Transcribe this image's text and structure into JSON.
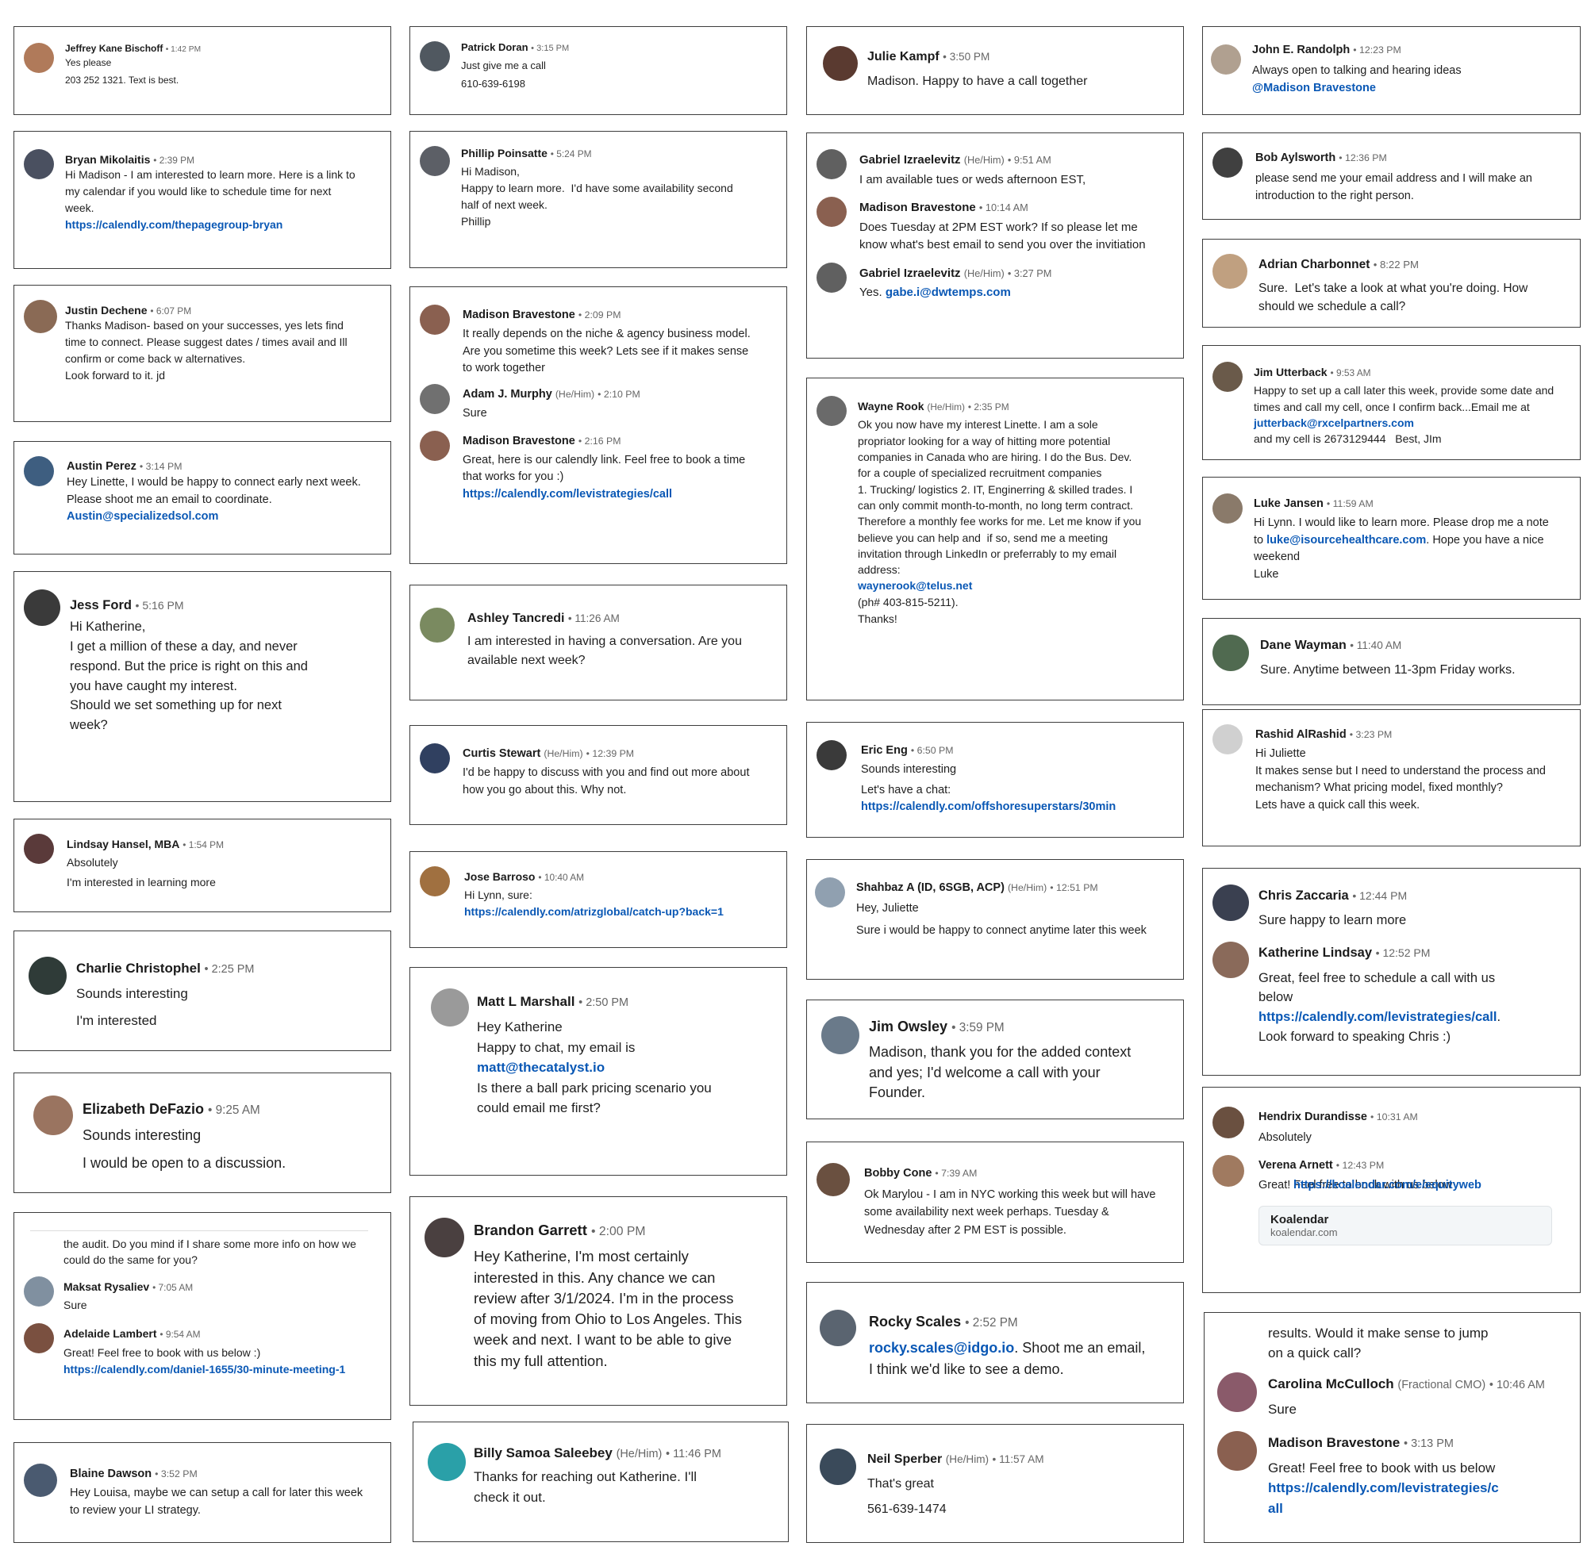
{
  "colors": {
    "link": "#0a58b5",
    "border": "#3d3d3d",
    "name": "#1b1b1b",
    "meta": "#666666"
  },
  "cards": [
    {
      "id": "c1",
      "messages": [
        {
          "name": "Jeffrey Kane Bischoff",
          "time": "1:42 PM",
          "lines": [
            "Yes please",
            "203 252 1321. Text is best."
          ]
        }
      ]
    },
    {
      "id": "c2",
      "messages": [
        {
          "name": "Bryan Mikolaitis",
          "time": "2:39 PM",
          "lines": [
            "Hi Madison - I am interested to learn more. Here is a link to my calendar if you would like to schedule time for next week.",
            ""
          ],
          "link": "https://calendly.com/thepagegroup-bryan"
        }
      ]
    },
    {
      "id": "c3",
      "messages": [
        {
          "name": "Justin Dechene",
          "time": "6:07 PM",
          "lines": [
            "Thanks Madison- based on your successes, yes lets find time to connect. Please suggest dates / times avail and Ill confirm or come back w alternatives.",
            "",
            "Look forward to it. jd"
          ]
        }
      ]
    },
    {
      "id": "c4",
      "messages": [
        {
          "name": "Austin Perez",
          "time": "3:14 PM",
          "lines": [
            "Hey Linette, I would be happy to connect early next week. Please shoot me an email to coordinate."
          ],
          "link": "Austin@specializedsol.com"
        }
      ]
    },
    {
      "id": "c5",
      "messages": [
        {
          "name": "Jess Ford",
          "time": "5:16 PM",
          "lines": [
            "Hi Katherine,",
            "",
            "I get a million of these a day, and never respond. But the price is right on this and you have caught my interest.",
            "",
            "Should we set something up for next week?"
          ]
        }
      ]
    },
    {
      "id": "c6",
      "messages": [
        {
          "name": "Lindsay Hansel, MBA",
          "time": "1:54 PM",
          "lines": [
            "Absolutely",
            "I'm interested in learning more"
          ]
        }
      ]
    },
    {
      "id": "c7",
      "messages": [
        {
          "name": "Charlie Christophel",
          "time": "2:25 PM",
          "lines": [
            "Sounds interesting",
            "I'm interested"
          ]
        }
      ]
    },
    {
      "id": "c8",
      "messages": [
        {
          "name": "Elizabeth DeFazio",
          "time": "9:25 AM",
          "lines": [
            "Sounds interesting",
            "I would be open to a discussion."
          ]
        }
      ]
    },
    {
      "id": "c9",
      "pre": "the audit. Do you mind if I share some more info on how we could do the same for you?",
      "messages": [
        {
          "name": "Maksat Rysaliev",
          "time": "7:05 AM",
          "lines": [
            "Sure"
          ]
        },
        {
          "name": "Adelaide Lambert",
          "time": "9:54 AM",
          "lines": [
            "Great! Feel free to book with us below :)"
          ],
          "link": "https://calendly.com/daniel-1655/30-minute-meeting-1"
        }
      ]
    },
    {
      "id": "c10",
      "messages": [
        {
          "name": "Blaine Dawson",
          "time": "3:52 PM",
          "lines": [
            "Hey Louisa, maybe we can setup a call for later this week to review your LI strategy."
          ]
        }
      ]
    },
    {
      "id": "c11",
      "messages": [
        {
          "name": "Patrick Doran",
          "time": "3:15 PM",
          "lines": [
            "Just give me a call",
            "610-639-6198"
          ]
        }
      ]
    },
    {
      "id": "c12",
      "messages": [
        {
          "name": "Phillip Poinsatte",
          "time": "5:24 PM",
          "lines": [
            "Hi Madison,",
            "",
            "Happy to learn more.  I'd have some availability second half of next week.",
            "",
            "Phillip"
          ]
        }
      ]
    },
    {
      "id": "c13",
      "messages": [
        {
          "name": "Madison Bravestone",
          "time": "2:09 PM",
          "lines": [
            "It really depends on the niche & agency business model. Are you sometime this week? Lets see if it makes sense to work together"
          ]
        },
        {
          "name": "Adam J. Murphy",
          "pronoun": "(He/Him)",
          "time": "2:10 PM",
          "lines": [
            "Sure"
          ]
        },
        {
          "name": "Madison Bravestone",
          "time": "2:16 PM",
          "lines": [
            "Great, here is our calendly link. Feel free to book a time that works for you :)"
          ],
          "link": "https://calendly.com/levistrategies/call"
        }
      ]
    },
    {
      "id": "c14",
      "messages": [
        {
          "name": "Ashley Tancredi",
          "time": "11:26 AM",
          "lines": [
            "I am interested in having a conversation. Are you available next week?"
          ]
        }
      ]
    },
    {
      "id": "c15",
      "messages": [
        {
          "name": "Curtis Stewart",
          "pronoun": "(He/Him)",
          "time": "12:39 PM",
          "lines": [
            "I'd be happy to discuss with you and find out more about how you go about this. Why not."
          ]
        }
      ]
    },
    {
      "id": "c16",
      "messages": [
        {
          "name": "Jose Barroso",
          "time": "10:40 AM",
          "lines": [
            "Hi Lynn, sure:"
          ],
          "link": "https://calendly.com/atrizglobal/catch-up?back=1"
        }
      ]
    },
    {
      "id": "c17",
      "messages": [
        {
          "name": "Matt L Marshall",
          "time": "2:50 PM",
          "lines": [
            "Hey Katherine",
            "",
            "Happy to chat, my email is"
          ],
          "link": "matt@thecatalyst.io",
          "after": [
            "",
            "Is there a ball park pricing scenario you could email me first?"
          ]
        }
      ]
    },
    {
      "id": "c18",
      "messages": [
        {
          "name": "Brandon Garrett",
          "time": "2:00 PM",
          "lines": [
            "Hey Katherine, I'm most certainly interested in this. Any chance we can review after 3/1/2024. I'm in the process of moving from Ohio to Los Angeles. This week and next. I want to be able to give this my full attention."
          ]
        }
      ]
    },
    {
      "id": "c19",
      "messages": [
        {
          "name": "Billy Samoa Saleebey",
          "pronoun": "(He/Him)",
          "time": "11:46 PM",
          "lines": [
            "Thanks for reaching out Katherine. I'll check it out."
          ]
        }
      ]
    },
    {
      "id": "c20",
      "messages": [
        {
          "name": "Julie Kampf",
          "time": "3:50 PM",
          "lines": [
            "Madison. Happy to have a call together"
          ]
        }
      ]
    },
    {
      "id": "c21",
      "messages": [
        {
          "name": "Gabriel Izraelevitz",
          "pronoun": "(He/Him)",
          "time": "9:51 AM",
          "lines": [
            "I am available tues or weds afternoon EST,"
          ]
        },
        {
          "name": "Madison Bravestone",
          "time": "10:14 AM",
          "lines": [
            "Does Tuesday at 2PM EST work? If so please let me know what's best email to send you over the invitiation"
          ]
        },
        {
          "name": "Gabriel Izraelevitz",
          "pronoun": "(He/Him)",
          "time": "3:27 PM",
          "lines": [
            "Yes. "
          ],
          "link": "gabe.i@dwtemps.com",
          "inline": true
        }
      ]
    },
    {
      "id": "c22",
      "messages": [
        {
          "name": "Wayne Rook",
          "pronoun": "(He/Him)",
          "time": "2:35 PM",
          "lines": [
            "Ok you now have my interest Linette. I am a sole propriator looking for a way of hitting more potential companies in Canada who are hiring. I do the Bus. Dev. for a couple of specialized recruitment companies",
            "1. Trucking/ logistics 2. IT, Enginerring & skilled trades. I can only commit month-to-month, no long term contract. Therefore a monthly fee works for me. Let me know if you believe you can help and  if so, send me a meeting invitation through LinkedIn or preferrably to my email address:"
          ],
          "link": "waynerook@telus.net",
          "after": [
            "(ph# 403-815-5211).",
            "",
            "Thanks!"
          ]
        }
      ]
    },
    {
      "id": "c23",
      "messages": [
        {
          "name": "Eric Eng",
          "time": "6:50 PM",
          "lines": [
            "Sounds interesting",
            "Let's have a chat:"
          ],
          "link": "https://calendly.com/offshoresuperstars/30min"
        }
      ]
    },
    {
      "id": "c24",
      "messages": [
        {
          "name": "Shahbaz A (ID, 6SGB, ACP)",
          "pronoun": "(He/Him)",
          "time": "12:51 PM",
          "lines": [
            "Hey, Juliette",
            "Sure i would be happy to connect anytime later this week"
          ]
        }
      ]
    },
    {
      "id": "c25",
      "messages": [
        {
          "name": "Jim Owsley",
          "time": "3:59 PM",
          "lines": [
            "Madison, thank you for the added context and yes; I'd welcome a call with your Founder."
          ]
        }
      ]
    },
    {
      "id": "c26",
      "messages": [
        {
          "name": "Bobby Cone",
          "time": "7:39 AM",
          "lines": [
            "Ok Marylou - I am in NYC working this week but will have some availability next week perhaps. Tuesday & Wednesday after 2 PM EST is possible."
          ]
        }
      ]
    },
    {
      "id": "c27",
      "messages": [
        {
          "name": "Rocky Scales",
          "time": "2:52 PM",
          "lines": [],
          "link": "rocky.scales@idgo.io",
          "after": [
            ". Shoot me an email, I think we'd like to see a demo."
          ],
          "linkfirst": true
        }
      ]
    },
    {
      "id": "c28",
      "messages": [
        {
          "name": "Neil Sperber",
          "pronoun": "(He/Him)",
          "time": "11:57 AM",
          "lines": [
            "That's great",
            "561-639-1474"
          ]
        }
      ]
    },
    {
      "id": "c29",
      "messages": [
        {
          "name": "John E. Randolph",
          "time": "12:23 PM",
          "lines": [
            "Always open to talking and hearing ideas"
          ],
          "link": "@Madison Bravestone"
        }
      ]
    },
    {
      "id": "c30",
      "messages": [
        {
          "name": "Bob Aylsworth",
          "time": "12:36 PM",
          "lines": [
            "please send me your email address and I will make an introduction to the right person."
          ]
        }
      ]
    },
    {
      "id": "c31",
      "messages": [
        {
          "name": "Adrian Charbonnet",
          "time": "8:22 PM",
          "lines": [
            "Sure.  Let's take a look at what you're doing. How should we schedule a call?"
          ]
        }
      ]
    },
    {
      "id": "c32",
      "messages": [
        {
          "name": "Jim Utterback",
          "time": "9:53 AM",
          "lines": [
            "Happy to set up a call later this week, provide some date and times and call my cell, once I confirm back...Email me at "
          ],
          "link": "jutterback@rxcelpartners.com",
          "after": [
            "and my cell is 2673129444   Best, JIm"
          ]
        }
      ]
    },
    {
      "id": "c33",
      "messages": [
        {
          "name": "Luke Jansen",
          "time": "11:59 AM",
          "lines": [
            "Hi Lynn. I would like to learn more. Please drop me a note to "
          ],
          "link": "luke@isourcehealthcare.com",
          "after": [
            "Hope you have a nice weekend",
            "Luke"
          ]
        }
      ]
    },
    {
      "id": "c34",
      "messages": [
        {
          "name": "Dane Wayman",
          "time": "11:40 AM",
          "lines": [
            "Sure. Anytime between 11-3pm Friday works."
          ]
        }
      ]
    },
    {
      "id": "c35",
      "messages": [
        {
          "name": "Rashid AlRashid",
          "time": "3:23 PM",
          "lines": [
            "Hi Juliette",
            "It makes sense but I need to understand the process and mechanism? What pricing model, fixed monthly?",
            "Lets have a quick call this week."
          ]
        }
      ]
    },
    {
      "id": "c36",
      "messages": [
        {
          "name": "Chris Zaccaria",
          "time": "12:44 PM",
          "lines": [
            "Sure happy to learn more"
          ]
        },
        {
          "name": "Katherine Lindsay",
          "time": "12:52 PM",
          "lines": [
            "Great, feel free to schedule a call with us below"
          ],
          "link": "https://calendly.com/levistrategies/call",
          "after": [
            "Look forward to speaking Chris :)"
          ]
        }
      ]
    },
    {
      "id": "c37",
      "messages": [
        {
          "name": "Hendrix Durandisse",
          "time": "10:31 AM",
          "lines": [
            "Absolutely"
          ]
        },
        {
          "name": "Verena Arnett",
          "time": "12:43 PM",
          "lines": [
            "Great! Feel free to book with us below"
          ],
          "link": "https://koalendar.com/e/equityweb",
          "preview": {
            "title": "Koalendar",
            "url": "koalendar.com"
          }
        }
      ]
    },
    {
      "id": "c38",
      "pre": "results. Would it make sense to jump on a quick call?",
      "messages": [
        {
          "name": "Carolina McCulloch",
          "pronoun": "(Fractional CMO)",
          "time": "10:46 AM",
          "lines": [
            "Sure"
          ]
        },
        {
          "name": "Madison Bravestone",
          "time": "3:13 PM",
          "lines": [
            "Great! Feel free to book with us below"
          ],
          "link": "https://calendly.com/levistrategies/call"
        }
      ]
    }
  ]
}
